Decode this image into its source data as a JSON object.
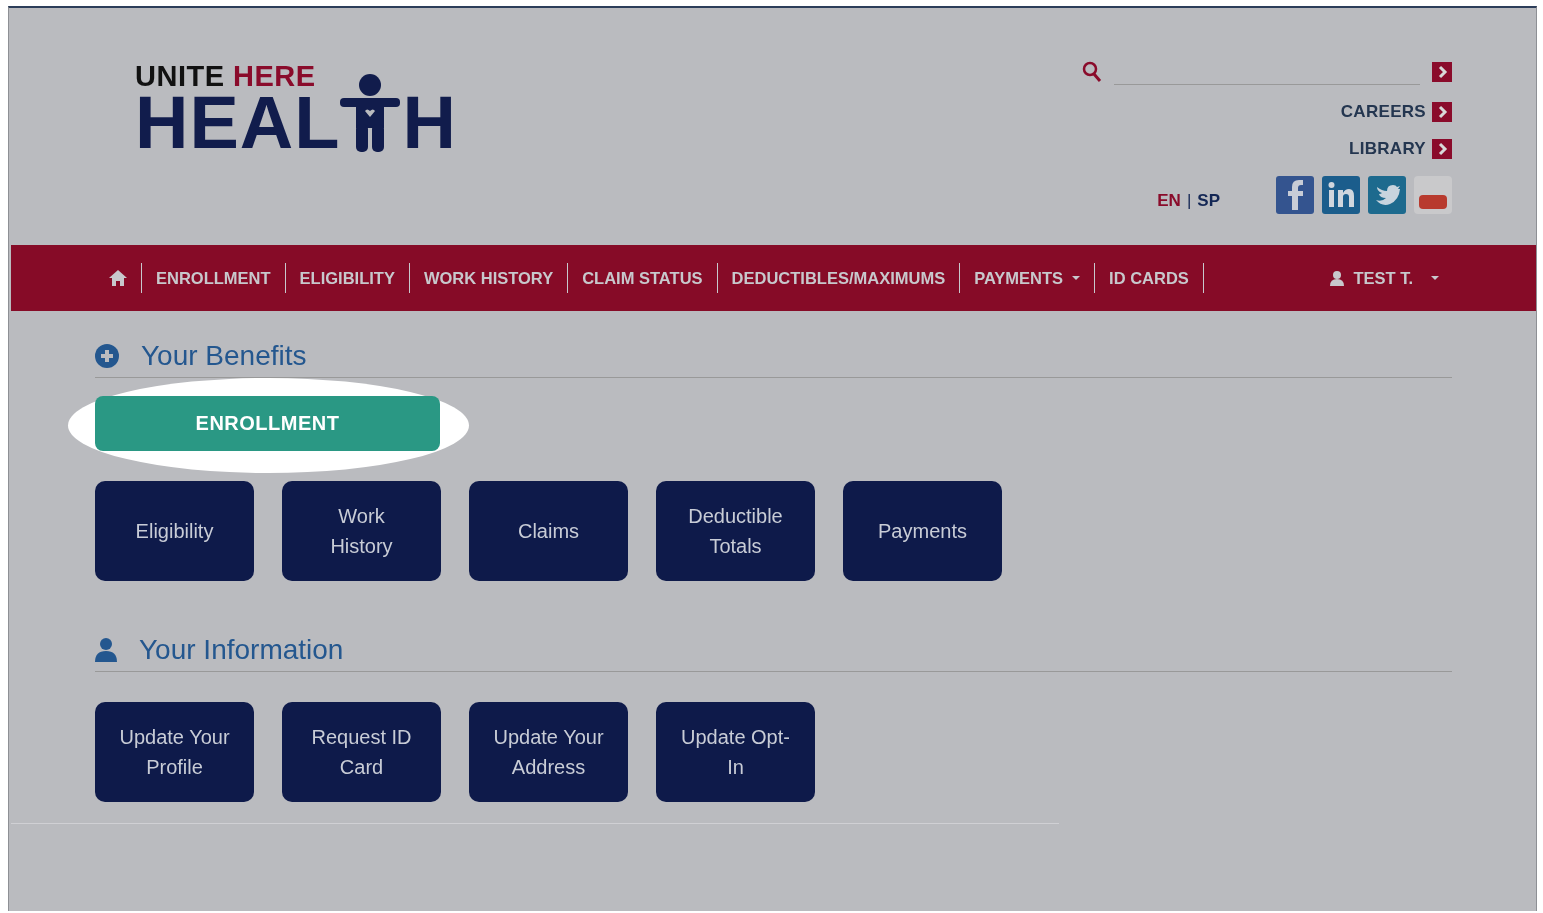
{
  "logo": {
    "word_1": "UNITE",
    "word_2": "HERE",
    "main_left": "HEAL",
    "main_right": "H"
  },
  "top_links": [
    {
      "label": "CAREERS"
    },
    {
      "label": "LIBRARY"
    }
  ],
  "languages": [
    {
      "label": "EN",
      "selected": true
    },
    {
      "label": "SP",
      "selected": false
    }
  ],
  "language_separator": "|",
  "social": [
    {
      "kind": "facebook"
    },
    {
      "kind": "linkedin"
    },
    {
      "kind": "twitter"
    },
    {
      "kind": "youtube"
    }
  ],
  "nav": {
    "items": [
      {
        "label": "ENROLLMENT",
        "dropdown": false
      },
      {
        "label": "ELIGIBILITY",
        "dropdown": false
      },
      {
        "label": "WORK HISTORY",
        "dropdown": false
      },
      {
        "label": "CLAIM STATUS",
        "dropdown": false
      },
      {
        "label": "DEDUCTIBLES/MAXIMUMS",
        "dropdown": false
      },
      {
        "label": "PAYMENTS",
        "dropdown": true
      },
      {
        "label": "ID CARDS",
        "dropdown": false
      }
    ],
    "user": "TEST T."
  },
  "sections": [
    {
      "title": "Your Benefits",
      "kind": "benefits",
      "featured": {
        "label": "ENROLLMENT",
        "highlighted": true
      },
      "tiles": [
        "Eligibility",
        "Work\nHistory",
        "Claims",
        "Deductible\nTotals",
        "Payments"
      ]
    },
    {
      "title": "Your Information",
      "kind": "information",
      "tiles": [
        "Update Your\nProfile",
        "Request ID\nCard",
        "Update Your\nAddress",
        "Update Opt-\nIn"
      ]
    }
  ]
}
